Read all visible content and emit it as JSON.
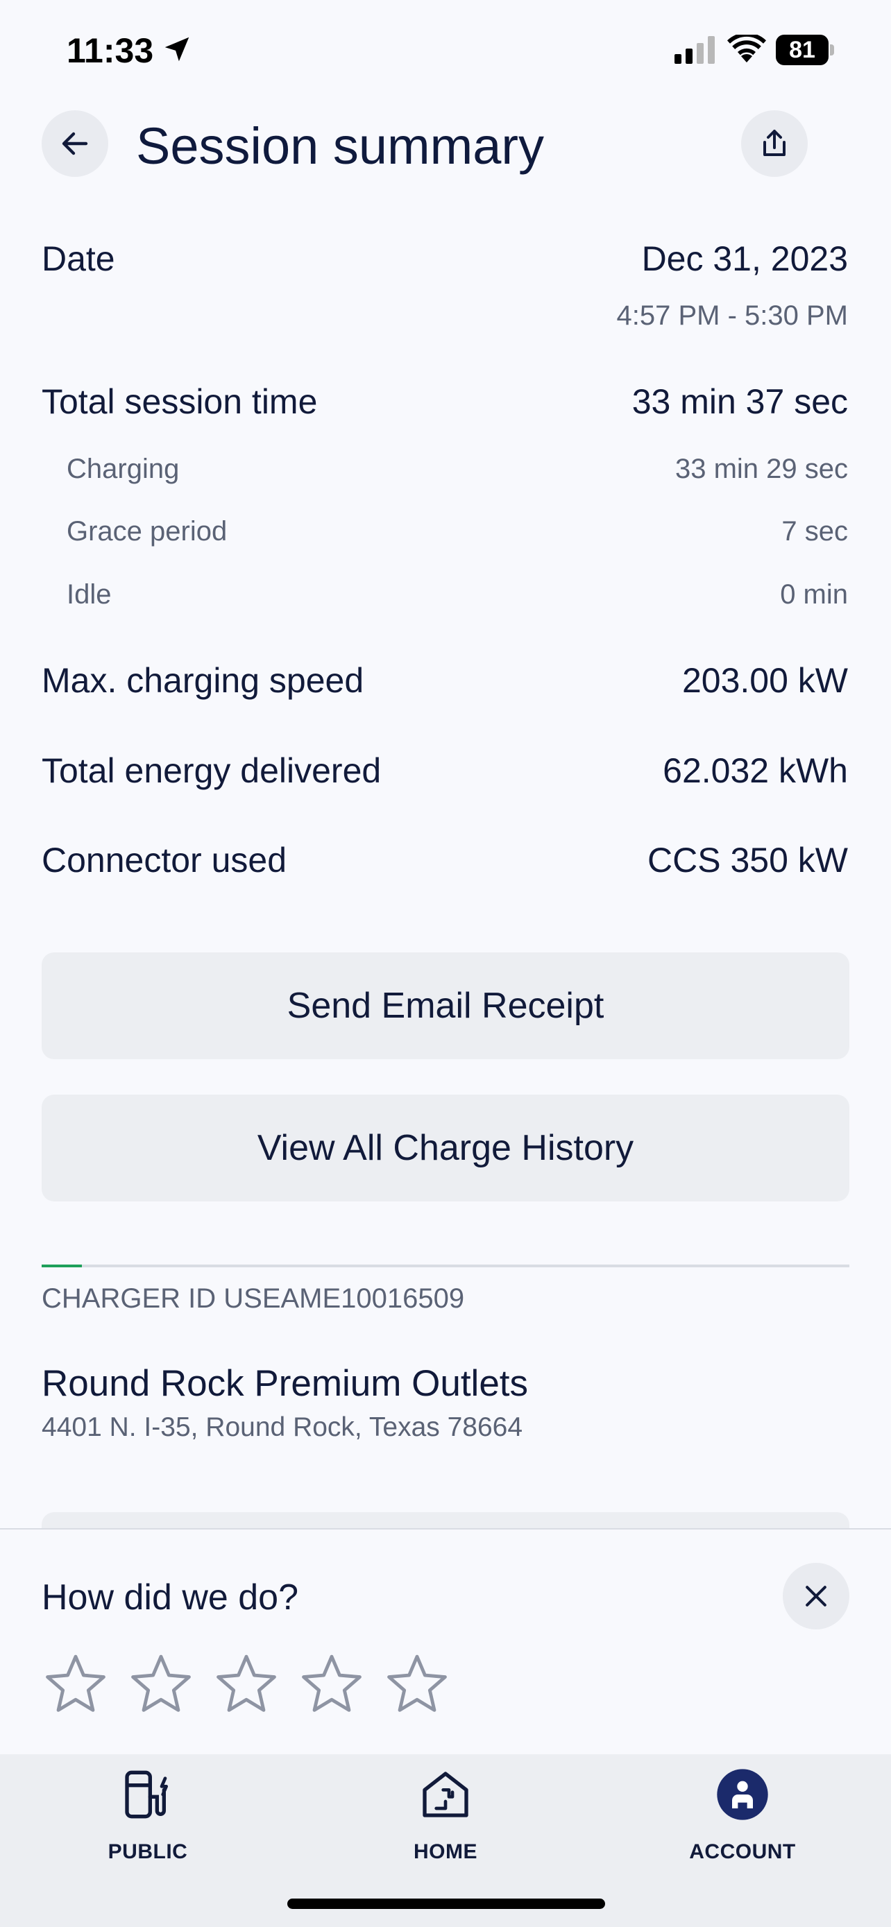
{
  "status_bar": {
    "time": "11:33",
    "battery": "81",
    "icons": [
      "location-arrow-icon",
      "cellular-signal-icon",
      "wifi-icon",
      "battery-icon"
    ]
  },
  "header": {
    "title": "Session summary",
    "back_icon": "arrow-left-icon",
    "share_icon": "share-icon"
  },
  "session": {
    "date_label": "Date",
    "date_value": "Dec 31, 2023",
    "time_range": "4:57 PM - 5:30 PM",
    "total_label": "Total session time",
    "total_value": "33 min 37 sec",
    "charging_label": "Charging",
    "charging_value": "33 min 29 sec",
    "grace_label": "Grace period",
    "grace_value": "7 sec",
    "idle_label": "Idle",
    "idle_value": "0 min",
    "max_speed_label": "Max. charging speed",
    "max_speed_value": "203.00 kW",
    "energy_label": "Total energy delivered",
    "energy_value": "62.032 kWh",
    "connector_label": "Connector used",
    "connector_value": "CCS 350 kW"
  },
  "actions": {
    "email_receipt": "Send Email Receipt",
    "charge_history": "View All Charge History"
  },
  "charger": {
    "id": "CHARGER ID USEAME10016509",
    "name": "Round Rock Premium Outlets",
    "address": "4401 N. I-35, Round Rock, Texas 78664",
    "carousel_progress_fraction": 0.05
  },
  "feedback": {
    "title": "How did we do?",
    "rating": 0,
    "max_rating": 5
  },
  "tabs": [
    {
      "label": "PUBLIC",
      "icon": "fuel-station-icon"
    },
    {
      "label": "HOME",
      "icon": "home-charger-icon"
    },
    {
      "label": "ACCOUNT",
      "icon": "account-icon",
      "active": true
    }
  ],
  "colors": {
    "background": "#f8f9fd",
    "text_primary": "#111a3a",
    "text_secondary": "#5a6275",
    "button_bg": "#eceef2",
    "accent_green": "#1fa05a",
    "star_outline": "#8e94a3"
  }
}
